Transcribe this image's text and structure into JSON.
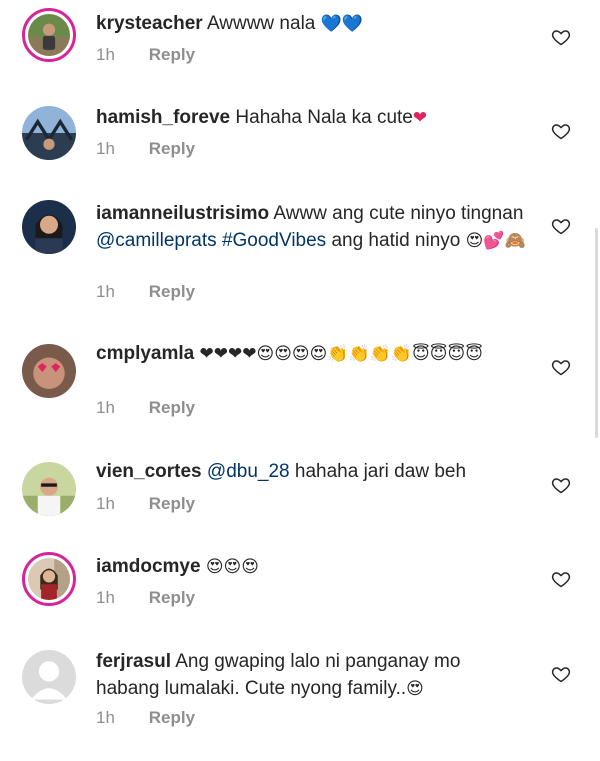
{
  "comments": [
    {
      "username": "krysteacher",
      "text": "Awwww nala",
      "emoji": "💙💙",
      "time": "1h",
      "reply": "Reply"
    },
    {
      "username": "hamish_foreve",
      "text": "Hahaha Nala ka cute",
      "emoji": "❤",
      "time": "1h",
      "reply": "Reply"
    },
    {
      "username": "iamanneilustrisimo",
      "text_a": "Awww ang cute ninyo tingnan",
      "mention": "@camilleprats",
      "hashtag": "#GoodVibes",
      "text_b": "ang hatid ninyo",
      "emoji": "😍💕🙈",
      "time": "1h",
      "reply": "Reply"
    },
    {
      "username": "cmplyamla",
      "emoji": "❤❤❤❤😍😍😍😍👏👏👏👏😇😇😇😇",
      "time": "1h",
      "reply": "Reply"
    },
    {
      "username": "vien_cortes",
      "mention": "@dbu_28",
      "text": "hahaha jari daw beh",
      "time": "1h",
      "reply": "Reply"
    },
    {
      "username": "iamdocmye",
      "emoji": "😍😍😍",
      "time": "1h",
      "reply": "Reply"
    },
    {
      "username": "ferjrasul",
      "text": "Ang gwaping lalo ni panganay mo habang lumalaki. Cute nyong family..",
      "emoji": "😍",
      "time": "1h",
      "reply": "Reply"
    }
  ],
  "icons": {
    "like": "heart-outline-icon",
    "default_avatar": "default-avatar-icon"
  },
  "colors": {
    "username": "#262626",
    "link": "#003569",
    "meta": "#8e8e8e",
    "story_ring": "#d6249f"
  }
}
